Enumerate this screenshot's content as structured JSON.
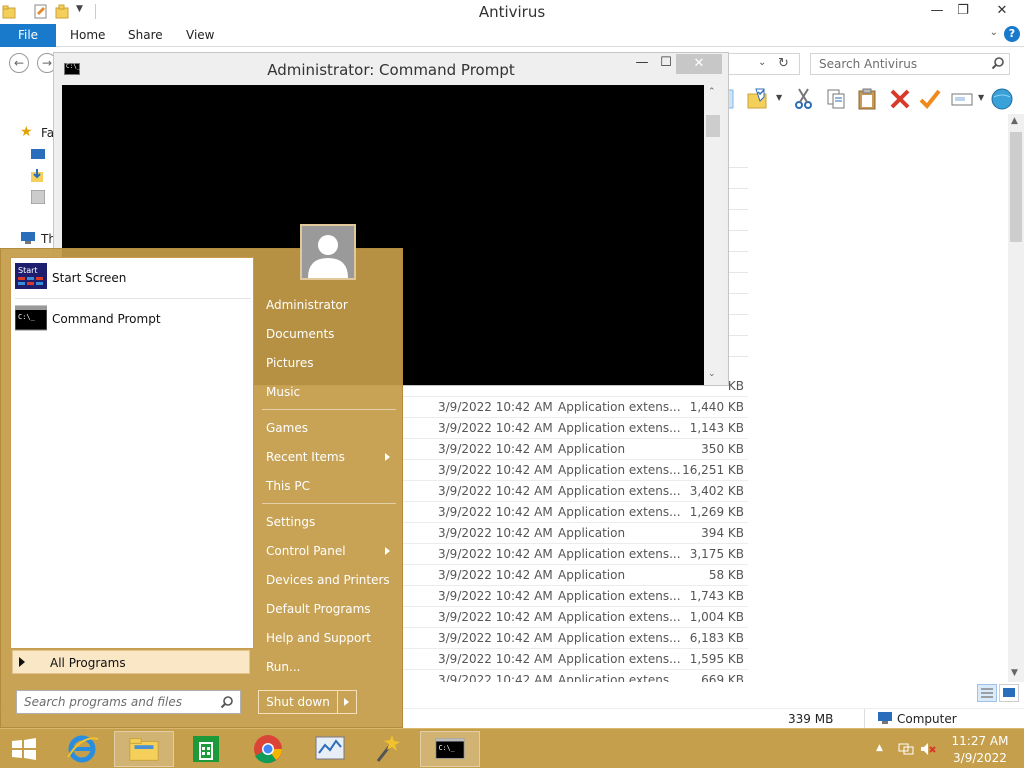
{
  "explorer": {
    "title": "Antivirus",
    "tabs": {
      "file": "File",
      "home": "Home",
      "share": "Share",
      "view": "View"
    },
    "help": "?",
    "search_placeholder": "Search Antivirus",
    "nav_pane": {
      "favorites": "Fa",
      "this_pc": "Th"
    },
    "file_rows": [
      {
        "date": "",
        "type": "",
        "size": "KB"
      },
      {
        "date": "3/9/2022 10:42 AM",
        "type": "Application extens...",
        "size": "1,440 KB"
      },
      {
        "date": "3/9/2022 10:42 AM",
        "type": "Application extens...",
        "size": "1,143 KB"
      },
      {
        "date": "3/9/2022 10:42 AM",
        "type": "Application",
        "size": "350 KB"
      },
      {
        "date": "3/9/2022 10:42 AM",
        "type": "Application extens...",
        "size": "16,251 KB"
      },
      {
        "date": "3/9/2022 10:42 AM",
        "type": "Application extens...",
        "size": "3,402 KB"
      },
      {
        "date": "3/9/2022 10:42 AM",
        "type": "Application extens...",
        "size": "1,269 KB"
      },
      {
        "date": "3/9/2022 10:42 AM",
        "type": "Application",
        "size": "394 KB"
      },
      {
        "date": "3/9/2022 10:42 AM",
        "type": "Application extens...",
        "size": "3,175 KB"
      },
      {
        "date": "3/9/2022 10:42 AM",
        "type": "Application",
        "size": "58 KB"
      },
      {
        "date": "3/9/2022 10:42 AM",
        "type": "Application extens...",
        "size": "1,743 KB"
      },
      {
        "date": "3/9/2022 10:42 AM",
        "type": "Application extens...",
        "size": "1,004 KB"
      },
      {
        "date": "3/9/2022 10:42 AM",
        "type": "Application extens...",
        "size": "6,183 KB"
      },
      {
        "date": "3/9/2022 10:42 AM",
        "type": "Application extens...",
        "size": "1,595 KB"
      },
      {
        "date": "3/9/2022 10:42 AM",
        "type": "Application extens...",
        "size": "669 KB"
      }
    ],
    "status": {
      "size": "339 MB",
      "location": "Computer"
    },
    "colors": {
      "file_tab": "#1979ca",
      "accent": "#1979ca"
    }
  },
  "cmd_window": {
    "title": "Administrator: Command Prompt",
    "icon_text": "C:\\_",
    "colors": {
      "console_bg": "#000000"
    }
  },
  "start_menu": {
    "pinned": [
      {
        "label": "Start Screen",
        "icon": "start-screen-icon",
        "icon_text": "Start"
      },
      {
        "label": "Command Prompt",
        "icon": "command-prompt-icon",
        "icon_text": "C:\\_"
      }
    ],
    "all_programs": "All Programs",
    "search_placeholder": "Search programs and files",
    "right_links": [
      {
        "label": "Administrator",
        "submenu": false
      },
      {
        "label": "Documents",
        "submenu": false
      },
      {
        "label": "Pictures",
        "submenu": false
      },
      {
        "label": "Music",
        "submenu": false
      },
      {
        "label": "Games",
        "submenu": false
      },
      {
        "label": "Recent Items",
        "submenu": true
      },
      {
        "label": "This PC",
        "submenu": false
      },
      {
        "label": "Settings",
        "submenu": false
      },
      {
        "label": "Control Panel",
        "submenu": true
      },
      {
        "label": "Devices and Printers",
        "submenu": false
      },
      {
        "label": "Default Programs",
        "submenu": false
      },
      {
        "label": "Help and Support",
        "submenu": false
      },
      {
        "label": "Run...",
        "submenu": false
      }
    ],
    "shutdown": "Shut down",
    "colors": {
      "background": "#c49c48",
      "highlight": "#f9e7c6"
    }
  },
  "taskbar": {
    "apps": [
      {
        "name": "start-button",
        "icon": "windows-logo-icon"
      },
      {
        "name": "internet-explorer",
        "icon": "ie-icon"
      },
      {
        "name": "file-explorer",
        "icon": "folder-icon"
      },
      {
        "name": "store",
        "icon": "store-icon"
      },
      {
        "name": "chrome",
        "icon": "chrome-icon"
      },
      {
        "name": "performance-monitor",
        "icon": "monitor-icon"
      },
      {
        "name": "wizard-tool",
        "icon": "magic-wand-icon"
      },
      {
        "name": "command-prompt",
        "icon": "cmd-icon"
      }
    ],
    "clock": {
      "time": "11:27 AM",
      "date": "3/9/2022"
    },
    "colors": {
      "background": "#c59f4c"
    }
  }
}
